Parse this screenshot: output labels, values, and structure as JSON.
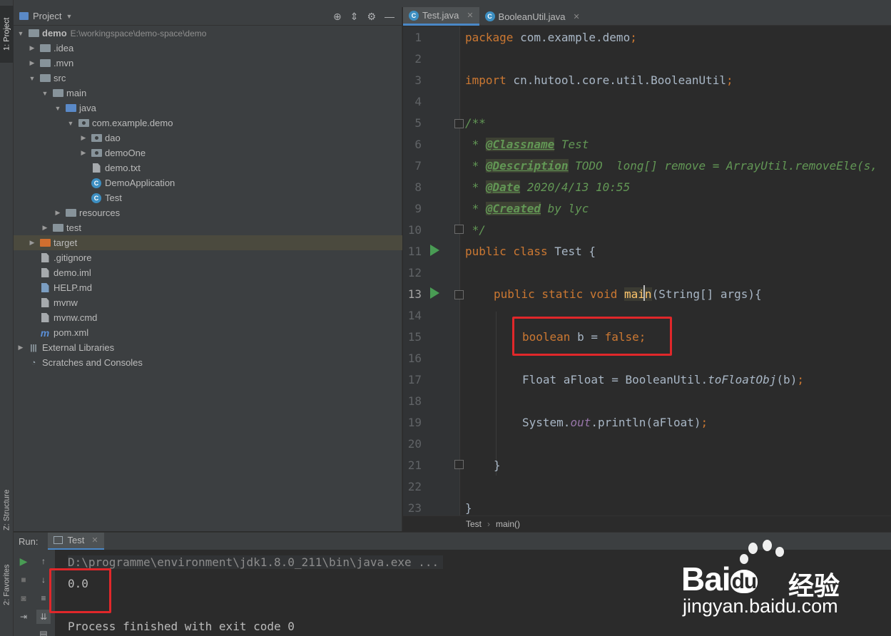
{
  "side_tabs": {
    "project": "1: Project",
    "structure": "Z: Structure",
    "favorites": "2: Favorites"
  },
  "project_panel": {
    "title": "Project",
    "tree": [
      {
        "label": "demo",
        "path": "E:\\workingspace\\demo-space\\demo"
      },
      {
        "label": ".idea"
      },
      {
        "label": ".mvn"
      },
      {
        "label": "src"
      },
      {
        "label": "main"
      },
      {
        "label": "java"
      },
      {
        "label": "com.example.demo"
      },
      {
        "label": "dao"
      },
      {
        "label": "demoOne"
      },
      {
        "label": "demo.txt"
      },
      {
        "label": "DemoApplication"
      },
      {
        "label": "Test"
      },
      {
        "label": "resources"
      },
      {
        "label": "test"
      },
      {
        "label": "target"
      },
      {
        "label": ".gitignore"
      },
      {
        "label": "demo.iml"
      },
      {
        "label": "HELP.md"
      },
      {
        "label": "mvnw"
      },
      {
        "label": "mvnw.cmd"
      },
      {
        "label": "pom.xml"
      },
      {
        "label": "External Libraries"
      },
      {
        "label": "Scratches and Consoles"
      }
    ]
  },
  "editor": {
    "tabs": [
      {
        "label": "Test.java"
      },
      {
        "label": "BooleanUtil.java"
      }
    ],
    "line_numbers": [
      "1",
      "2",
      "3",
      "4",
      "5",
      "6",
      "7",
      "8",
      "9",
      "10",
      "11",
      "12",
      "13",
      "14",
      "15",
      "16",
      "17",
      "18",
      "19",
      "20",
      "21",
      "22",
      "23"
    ],
    "code": {
      "l1": {
        "kw": "package",
        "rest": " com.example.demo",
        "semi": ";"
      },
      "l3": {
        "kw": "import",
        "rest": " cn.hutool.core.util.BooleanUtil",
        "semi": ";"
      },
      "l5": "/**",
      "l6": {
        "star": " * ",
        "tag": "@Classname",
        "rest": " Test"
      },
      "l7": {
        "star": " * ",
        "tag": "@Description",
        "rest": " TODO  long[] remove = ArrayUtil.removeEle(s,"
      },
      "l8": {
        "star": " * ",
        "tag": "@Date",
        "rest": " 2020/4/13 10:55"
      },
      "l9": {
        "star": " * ",
        "tag": "@Created",
        "rest": " by lyc"
      },
      "l10": " */",
      "l11": {
        "kw": "public class",
        "rest": " Test {"
      },
      "l13": {
        "kw": "public static void",
        "name_a": "ma",
        "name_b": "in",
        "rest": "(String[] args){"
      },
      "l15": {
        "kw": "boolean",
        "rest": " b = ",
        "kw2": "false",
        "semi": ";"
      },
      "l17": {
        "a": "Float aFloat = BooleanUtil.",
        "method": "toFloatObj",
        "b": "(b)",
        "semi": ";"
      },
      "l19": {
        "a": "System.",
        "field": "out",
        "b": ".println(aFloat)",
        "semi": ";"
      },
      "l21": "}",
      "l23": "}"
    }
  },
  "breadcrumb": {
    "class": "Test",
    "method": "main()"
  },
  "run_panel": {
    "label": "Run:",
    "tab": "Test",
    "console": {
      "command": "D:\\programme\\environment\\jdk1.8.0_211\\bin\\java.exe ...",
      "output": "0.0",
      "finished": "Process finished with exit code 0"
    }
  },
  "watermark": {
    "brand_a": "Bai",
    "brand_b": "du",
    "brand_cn": "经验",
    "url": "jingyan.baidu.com"
  },
  "colors": {
    "keyword": "#cc7832",
    "comment": "#629755",
    "highlight_box": "#e0272a",
    "panel": "#3c3f41",
    "editor": "#2b2b2b"
  }
}
